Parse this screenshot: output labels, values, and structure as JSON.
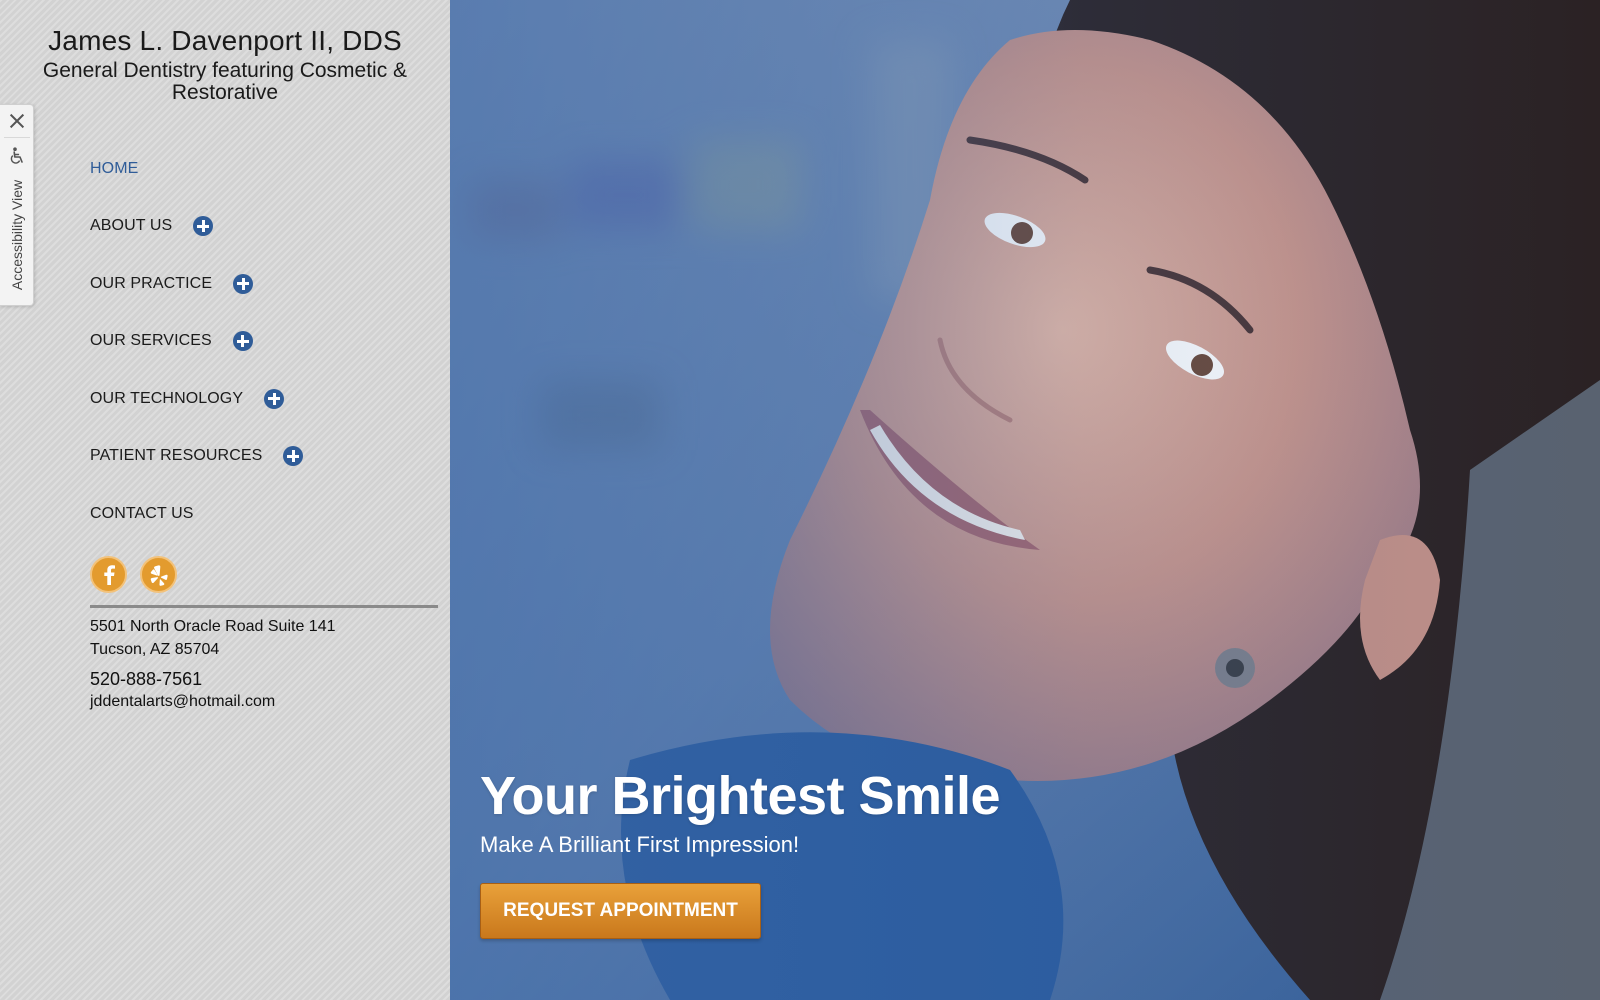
{
  "brand": {
    "name": "James L. Davenport II, DDS",
    "tagline": "General Dentistry featuring Cosmetic & Restorative"
  },
  "nav": {
    "home": "HOME",
    "about": "ABOUT US",
    "practice": "OUR PRACTICE",
    "services": "OUR SERVICES",
    "technology": "OUR TECHNOLOGY",
    "resources": "PATIENT RESOURCES",
    "contact": "CONTACT US"
  },
  "social": {
    "icons": [
      "facebook-icon",
      "yelp-icon"
    ],
    "color": "#e39b2e"
  },
  "contact": {
    "address_line1": "5501 North Oracle Road Suite 141",
    "address_line2": "Tucson, AZ 85704",
    "phone": "520-888-7561",
    "email": "jddentalarts@hotmail.com"
  },
  "accessibility": {
    "label": "Accessibility View",
    "icons": [
      "close-icon",
      "wheelchair-icon"
    ]
  },
  "hero": {
    "title": "Your Brightest Smile",
    "subtitle": "Make A Brilliant First Impression!",
    "cta": "REQUEST APPOINTMENT"
  },
  "colors": {
    "accent_blue": "#2f5c98",
    "accent_orange": "#e39b2e",
    "sidebar_bg": "#d6d6d6"
  }
}
